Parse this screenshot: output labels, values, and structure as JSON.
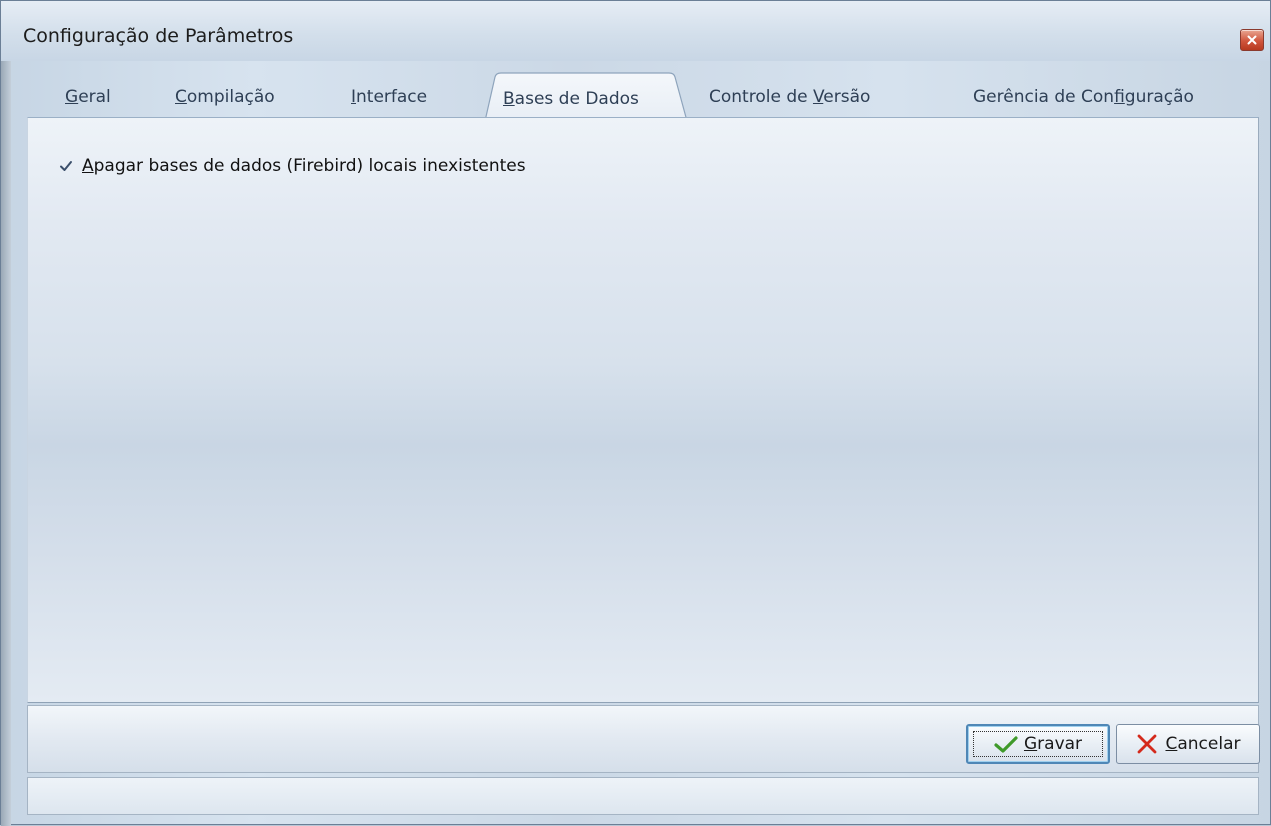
{
  "window": {
    "title": "Configuração de Parâmetros"
  },
  "tabs": [
    {
      "pre": "",
      "hot": "G",
      "post": "eral",
      "active": false
    },
    {
      "pre": "",
      "hot": "C",
      "post": "ompilação",
      "active": false
    },
    {
      "pre": "",
      "hot": "I",
      "post": "nterface",
      "active": false
    },
    {
      "pre": "",
      "hot": "B",
      "post": "ases de Dados",
      "active": true
    },
    {
      "pre": "Controle de ",
      "hot": "V",
      "post": "ersão",
      "active": false
    },
    {
      "pre": "Gerência de Con",
      "hot": "f",
      "post": "iguração",
      "active": false
    }
  ],
  "panel": {
    "checkbox": {
      "checked": true,
      "hot": "A",
      "rest": "pagar bases de dados (Firebird) locais inexistentes"
    }
  },
  "buttons": {
    "save": {
      "hot": "G",
      "rest": "ravar",
      "icon": "checkmark-icon"
    },
    "cancel": {
      "hot": "C",
      "rest": "ancelar",
      "icon": "x-icon"
    }
  },
  "status": {
    "text": ""
  },
  "colors": {
    "save_check": "#3f9a2a",
    "cancel_x": "#d42a1c",
    "close_btn": "#c8442a"
  }
}
